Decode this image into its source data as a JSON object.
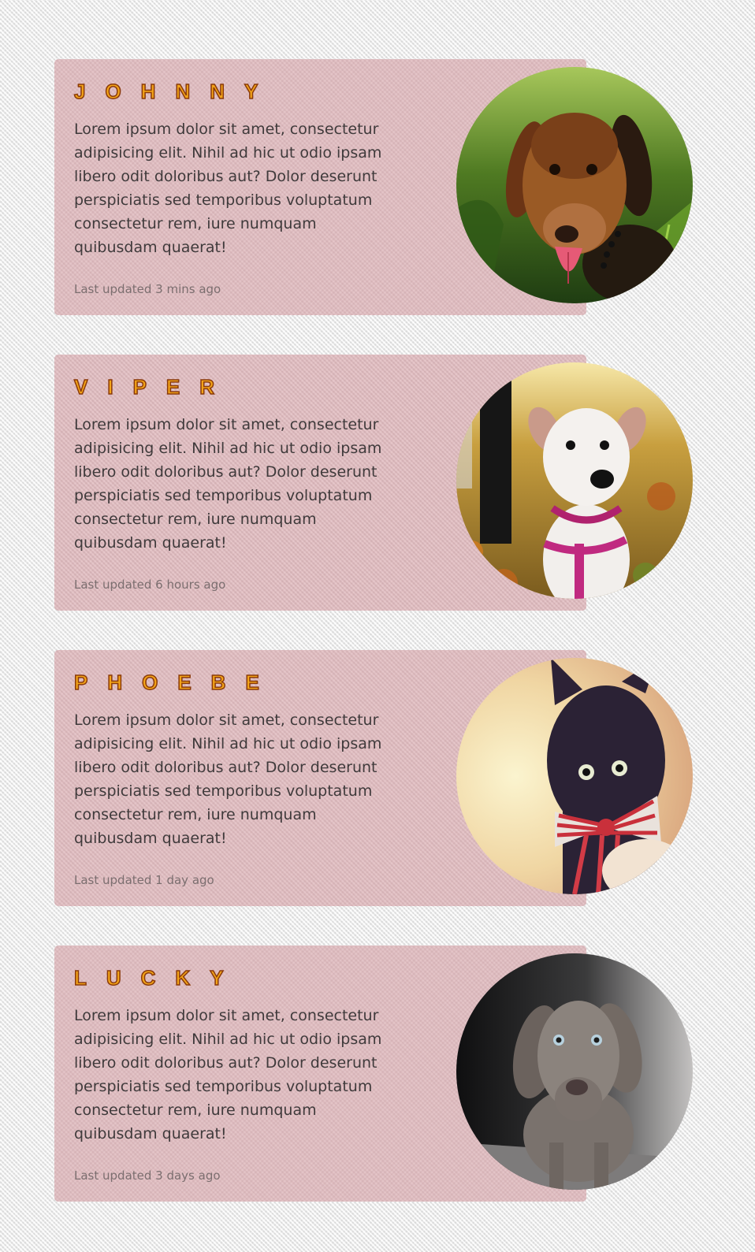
{
  "cards": [
    {
      "name": "Johnny",
      "text": "Lorem ipsum dolor sit amet, consectetur adipisicing elit. Nihil ad hic ut odio ipsam libero odit doloribus aut? Dolor deserunt perspiciatis sed temporibus voluptatum consectetur rem, iure numquam quibusdam quaerat!",
      "updated": "Last updated 3 mins ago",
      "photo": "dog-terrier-tongue-out-photo"
    },
    {
      "name": "Viper",
      "text": "Lorem ipsum dolor sit amet, consectetur adipisicing elit. Nihil ad hic ut odio ipsam libero odit doloribus aut? Dolor deserunt perspiciatis sed temporibus voluptatum consectetur rem, iure numquam quibusdam quaerat!",
      "updated": "Last updated 6 hours ago",
      "photo": "white-puppy-pink-harness-photo"
    },
    {
      "name": "Phoebe",
      "text": "Lorem ipsum dolor sit amet, consectetur adipisicing elit. Nihil ad hic ut odio ipsam libero odit doloribus aut? Dolor deserunt perspiciatis sed temporibus voluptatum consectetur rem, iure numquam quibusdam quaerat!",
      "updated": "Last updated 1 day ago",
      "photo": "black-kitten-bow-tie-photo"
    },
    {
      "name": "Lucky",
      "text": "Lorem ipsum dolor sit amet, consectetur adipisicing elit. Nihil ad hic ut odio ipsam libero odit doloribus aut? Dolor deserunt perspiciatis sed temporibus voluptatum consectetur rem, iure numquam quibusdam quaerat!",
      "updated": "Last updated 3 days ago",
      "photo": "grey-weimaraner-puppy-photo"
    }
  ],
  "colors": {
    "card_background": "#deb4b8",
    "title_fill": "#f3a418",
    "title_outline": "#8a3a0a",
    "body_text": "#3f3a3b",
    "muted_text": "#7b6e6f"
  }
}
